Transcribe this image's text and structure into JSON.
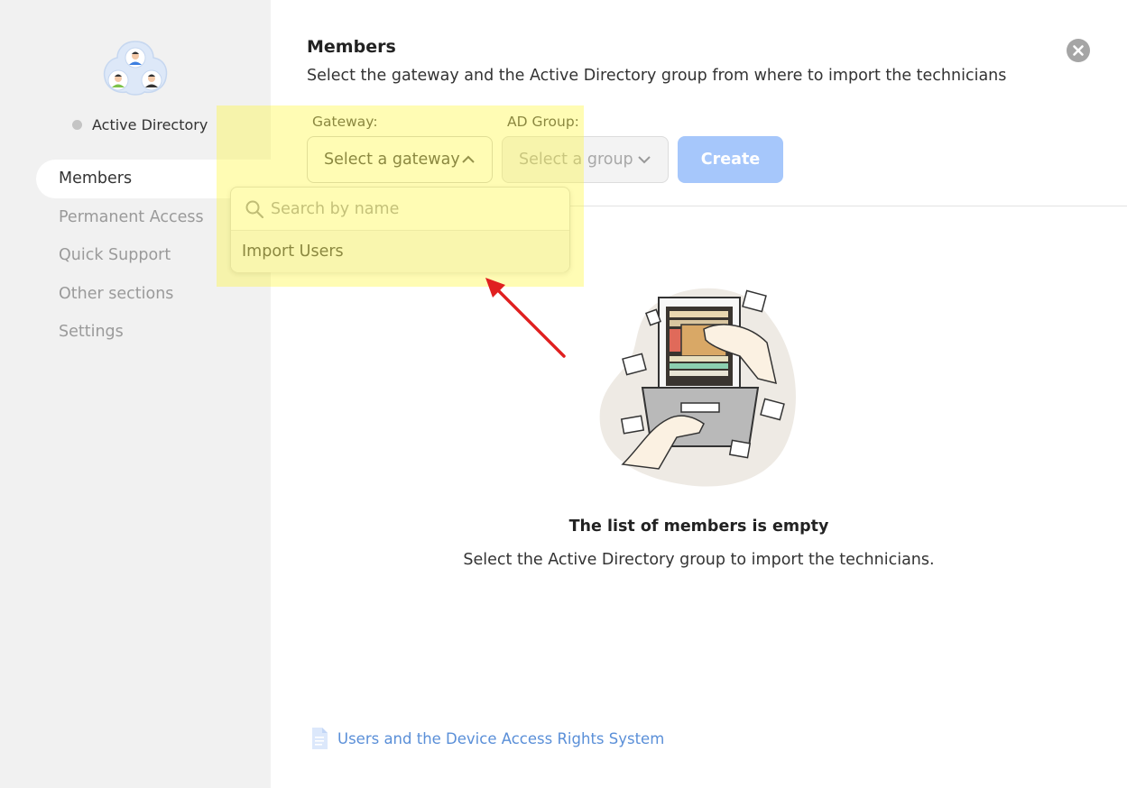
{
  "sidebar": {
    "status_label": "Active Directory",
    "items": [
      {
        "label": "Members",
        "active": true
      },
      {
        "label": "Permanent Access",
        "active": false
      },
      {
        "label": "Quick Support",
        "active": false
      },
      {
        "label": "Other sections",
        "active": false
      },
      {
        "label": "Settings",
        "active": false
      }
    ]
  },
  "main": {
    "title": "Members",
    "subtitle": "Select the gateway and the Active Directory group from where to import the technicians",
    "gateway_label": "Gateway:",
    "gateway_placeholder": "Select a gateway",
    "group_label": "AD Group:",
    "group_placeholder": "Select a group",
    "create_label": "Create",
    "dropdown": {
      "search_placeholder": "Search by name",
      "options": [
        "Import Users"
      ]
    },
    "empty_title": "The list of members is empty",
    "empty_text": "Select the Active Directory group to import the technicians.",
    "doc_link": "Users and the Device Access Rights System"
  },
  "colors": {
    "accent_blue": "#a6c7fb",
    "link_blue": "#5a8fd8",
    "highlight_yellow": "#fff73a",
    "arrow_red": "#e02020"
  }
}
